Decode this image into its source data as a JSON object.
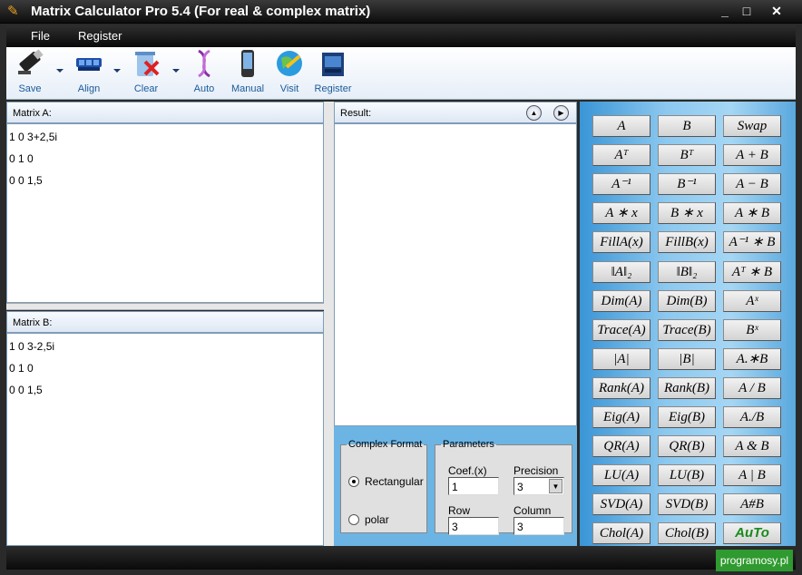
{
  "window": {
    "title": "Matrix Calculator Pro 5.4 (For real & complex matrix)"
  },
  "menu": {
    "items": [
      "File",
      "Register"
    ]
  },
  "toolbar": {
    "buttons": [
      {
        "label": "Save",
        "icon": "usb-drive-icon"
      },
      {
        "label": "Align",
        "icon": "align-icon"
      },
      {
        "label": "Clear",
        "icon": "clear-bin-icon"
      },
      {
        "label": "Auto",
        "icon": "dna-icon"
      },
      {
        "label": "Manual",
        "icon": "phone-icon"
      },
      {
        "label": "Visit",
        "icon": "globe-icon"
      },
      {
        "label": "Register",
        "icon": "register-box-icon"
      }
    ]
  },
  "matrixA": {
    "label": "Matrix A:",
    "lines": [
      "1 0 3+2,5i",
      "0 1 0",
      "0 0 1,5"
    ]
  },
  "matrixB": {
    "label": "Matrix B:",
    "lines": [
      "1 0 3-2,5i",
      "0 1 0",
      "0 0 1,5"
    ]
  },
  "result": {
    "label": "Result:"
  },
  "complex_format": {
    "legend": "Complex Format",
    "options": [
      "Rectangular",
      "polar"
    ],
    "selected": "Rectangular"
  },
  "parameters": {
    "legend": "Parameters",
    "coef_label": "Coef.(x)",
    "coef_value": "1",
    "precision_label": "Precision",
    "precision_value": "3",
    "row_label": "Row",
    "row_value": "3",
    "column_label": "Column",
    "column_value": "3"
  },
  "buttons": [
    [
      "A",
      "B",
      "Swap"
    ],
    [
      "Aᵀ",
      "Bᵀ",
      "A + B"
    ],
    [
      "A⁻¹",
      "B⁻¹",
      "A − B"
    ],
    [
      "A ∗ x",
      "B ∗ x",
      "A ∗ B"
    ],
    [
      "FillA(x)",
      "FillB(x)",
      "A⁻¹ ∗ B"
    ],
    [
      "‖A‖₂",
      "‖B‖₂",
      "Aᵀ ∗ B"
    ],
    [
      "Dim(A)",
      "Dim(B)",
      "Aˣ"
    ],
    [
      "Trace(A)",
      "Trace(B)",
      "Bˣ"
    ],
    [
      "|A|",
      "|B|",
      "A.∗B"
    ],
    [
      "Rank(A)",
      "Rank(B)",
      "A / B"
    ],
    [
      "Eig(A)",
      "Eig(B)",
      "A./B"
    ],
    [
      "QR(A)",
      "QR(B)",
      "A & B"
    ],
    [
      "LU(A)",
      "LU(B)",
      "A | B"
    ],
    [
      "SVD(A)",
      "SVD(B)",
      "A#B"
    ],
    [
      "Chol(A)",
      "Chol(B)",
      "AuTo"
    ]
  ],
  "brand": "programosy.pl"
}
